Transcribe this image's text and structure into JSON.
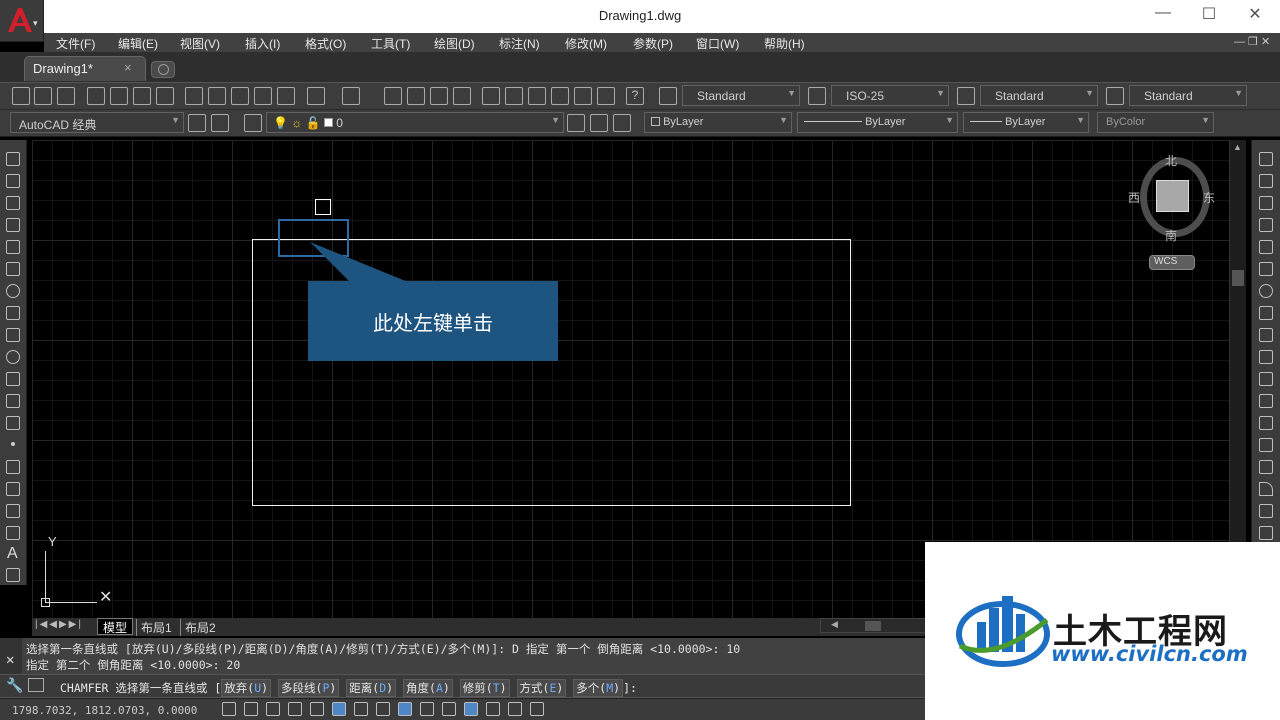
{
  "window": {
    "title": "Drawing1.dwg",
    "app_menu_arrow": "▾",
    "min": "—",
    "max": "☐",
    "close": "✕"
  },
  "menu": [
    "文件(F)",
    "编辑(E)",
    "视图(V)",
    "插入(I)",
    "格式(O)",
    "工具(T)",
    "绘图(D)",
    "标注(N)",
    "修改(M)",
    "参数(P)",
    "窗口(W)",
    "帮助(H)"
  ],
  "doc_tab": {
    "label": "Drawing1*",
    "close": "×"
  },
  "toolbar": {
    "text_style": "Standard",
    "dim_style": "ISO-25",
    "table_style": "Standard",
    "mleader_style": "Standard",
    "workspace": "AutoCAD 经典",
    "layer": "0",
    "color": "ByLayer",
    "linetype": "ByLayer",
    "lineweight": "ByLayer",
    "plotstyle": "ByColor"
  },
  "viewcube": {
    "north": "北",
    "south": "南",
    "west": "西",
    "east": "东",
    "wcs": "WCS"
  },
  "callout_text": "此处左键单击",
  "ucs": {
    "y": "Y"
  },
  "layout_tabs": [
    "模型",
    "布局1",
    "布局2"
  ],
  "command_history": [
    "选择第一条直线或 [放弃(U)/多段线(P)/距离(D)/角度(A)/修剪(T)/方式(E)/多个(M)]: D 指定 第一个 倒角距离 <10.0000>: 10",
    "指定 第二个 倒角距离 <10.0000>: 20"
  ],
  "command_line": {
    "command": "CHAMFER",
    "prompt": "选择第一条直线或",
    "options": [
      {
        "text": "放弃",
        "key": "U"
      },
      {
        "text": "多段线",
        "key": "P"
      },
      {
        "text": "距离",
        "key": "D"
      },
      {
        "text": "角度",
        "key": "A"
      },
      {
        "text": "修剪",
        "key": "T"
      },
      {
        "text": "方式",
        "key": "E"
      },
      {
        "text": "多个",
        "key": "M"
      }
    ],
    "suffix": ":"
  },
  "coordinates": "1798.7032, 1812.0703, 0.0000",
  "watermark": {
    "brand": "土木工程网",
    "url": "www.civilcn.com",
    "brand_color": "#1a1a1a",
    "accent": "#1d6fc4"
  },
  "colors": {
    "accent_blue": "#1d5480",
    "selection_blue": "#2d6aa3",
    "app_red": "#c8102e"
  }
}
